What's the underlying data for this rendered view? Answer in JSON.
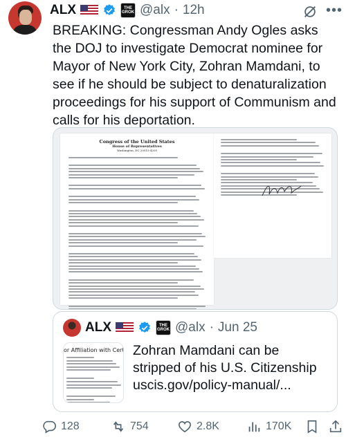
{
  "post": {
    "author_name": "ALX",
    "handle": "@alx",
    "separator": "·",
    "time": "12h",
    "affiliate_label": "THE\nGROK",
    "text": "BREAKING: Congressman Andy Ogles asks the DOJ to investigate Democrat nominee for Mayor of New York City, Zohran Mamdani, to see if he should be subject to denaturalization proceedings for his support of Communism and calls for his deportation.",
    "icons": [
      "flag-us-icon",
      "verified-badge-icon",
      "affiliate-badge-icon",
      "grok-icon",
      "more-icon"
    ]
  },
  "document": {
    "title_line1": "Congress of the United States",
    "title_line2": "House of Representatives",
    "title_line3": "Washington, DC 20515-4205"
  },
  "quote": {
    "author_name": "ALX",
    "handle": "@alx",
    "separator": "·",
    "time": "Jun 25",
    "thumb_title": "or Affiliation with Certain Orga",
    "text": "Zohran Mamdani can be stripped of his U.S. Citizenship uscis.gov/policy-manual/..."
  },
  "actions": {
    "replies": "128",
    "reposts": "754",
    "likes": "2.8K",
    "views": "170K"
  },
  "colors": {
    "text": "#0f1419",
    "secondary": "#536471",
    "border": "#cfd9de",
    "verified": "#1d9bf0"
  }
}
